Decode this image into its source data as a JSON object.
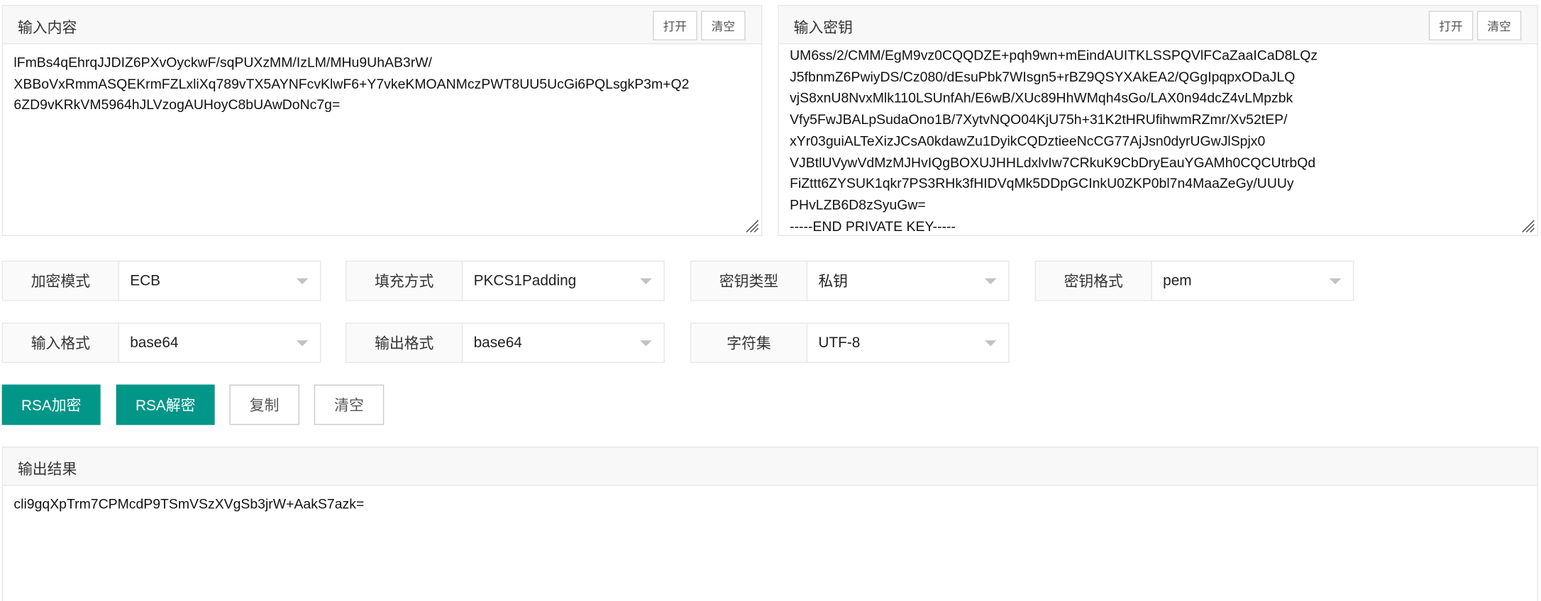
{
  "input_panel": {
    "title": "输入内容",
    "open_label": "打开",
    "clear_label": "清空",
    "lines": [
      "lFmBs4qEhrqJJDIZ6PXvOyckwF/sqPUXzMM/IzLM/MHu9UhAB3rW/",
      "XBBoVxRmmASQEKrmFZLxliXq789vTX5AYNFcvKlwF6+Y7vkeKMOANMczPWT8UU5UcGi6PQLsgkP3m+Q2",
      "6ZD9vKRkVM5964hJLVzogAUHoyC8bUAwDoNc7g="
    ]
  },
  "key_panel": {
    "title": "输入密钥",
    "open_label": "打开",
    "clear_label": "清空",
    "lines": [
      "UM6ss/2/CMM/EgM9vz0CQQDZE+pqh9wn+mEindAUITKLSSPQVlFCaZaaICaD8LQz",
      "J5fbnmZ6PwiyDS/Cz080/dEsuPbk7WIsgn5+rBZ9QSYXAkEA2/QGgIpqpxODaJLQ",
      "vjS8xnU8NvxMlk110LSUnfAh/E6wB/XUc89HhWMqh4sGo/LAX0n94dcZ4vLMpzbk",
      "Vfy5FwJBALpSudaOno1B/7XytvNQO04KjU75h+31K2tHRUfihwmRZmr/Xv52tEP/",
      "xYr03guiALTeXizJCsA0kdawZu1DyikCQDztieeNcCG77AjJsn0dyrUGwJlSpjx0",
      "VJBtlUVywVdMzMJHvIQgBOXUJHHLdxlvIw7CRkuK9CbDryEauYGAMh0CQCUtrbQd",
      "FiZttt6ZYSUK1qkr7PS3RHk3fHIDVqMk5DDpGCInkU0ZKP0bl7n4MaaZeGy/UUUy",
      "PHvLZB6D8zSyuGw=",
      "-----END PRIVATE KEY-----"
    ]
  },
  "options": {
    "mode": {
      "label": "加密模式",
      "value": "ECB"
    },
    "padding": {
      "label": "填充方式",
      "value": "PKCS1Padding"
    },
    "key_type": {
      "label": "密钥类型",
      "value": "私钥"
    },
    "key_format": {
      "label": "密钥格式",
      "value": "pem"
    },
    "input_fmt": {
      "label": "输入格式",
      "value": "base64"
    },
    "output_fmt": {
      "label": "输出格式",
      "value": "base64"
    },
    "charset": {
      "label": "字符集",
      "value": "UTF-8"
    }
  },
  "actions": {
    "encrypt_label": "RSA加密",
    "decrypt_label": "RSA解密",
    "copy_label": "复制",
    "clear_label": "清空"
  },
  "output_panel": {
    "title": "输出结果",
    "value": "cli9gqXpTrm7CPMcdP9TSmVSzXVgSb3jrW+AakS7azk="
  },
  "colors": {
    "primary": "#009688",
    "border": "#e6e6e6",
    "header_bg": "#f8f8f8"
  }
}
